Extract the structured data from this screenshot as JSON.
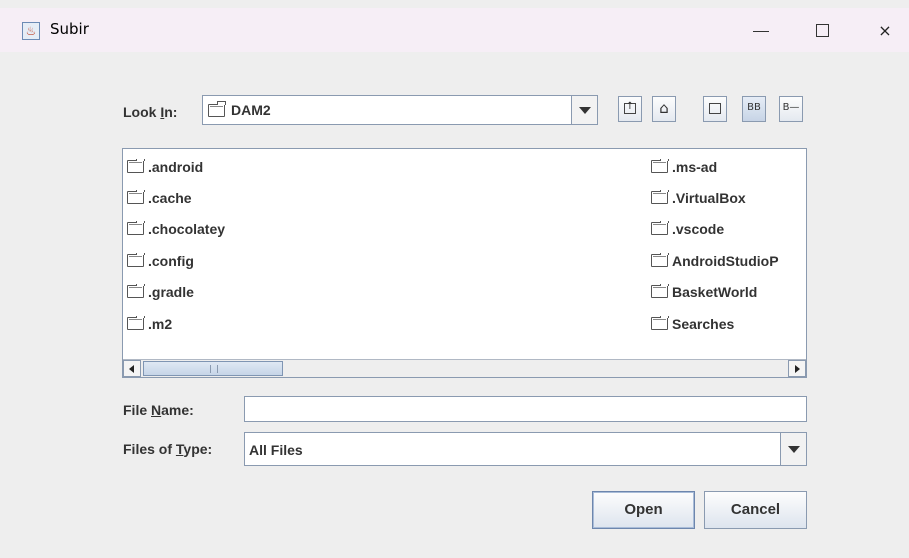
{
  "window": {
    "title": "Subir",
    "controls": {
      "minimize": "minimize",
      "maximize": "maximize",
      "close": "×"
    }
  },
  "toolbar": {
    "look_in_label_prefix": "Look ",
    "look_in_label_mnemonic": "I",
    "look_in_label_suffix": "n:",
    "current_folder": "DAM2",
    "buttons": [
      "up-one-level",
      "home",
      "create-new-folder",
      "list-view",
      "details-view"
    ],
    "list_view_glyph": "BB",
    "details_view_glyph": "B—"
  },
  "files": [
    {
      "name": ".android"
    },
    {
      "name": ".cache"
    },
    {
      "name": ".chocolatey"
    },
    {
      "name": ".config"
    },
    {
      "name": ".gradle"
    },
    {
      "name": ".m2"
    },
    {
      "name": ".ms-ad"
    },
    {
      "name": ".VirtualBox"
    },
    {
      "name": ".vscode"
    },
    {
      "name": "AndroidStudioP"
    },
    {
      "name": "BasketWorld"
    },
    {
      "name": "Searches"
    }
  ],
  "scrollbar": {
    "grip": "III"
  },
  "form": {
    "file_name_label_prefix": "File ",
    "file_name_label_mnemonic": "N",
    "file_name_label_suffix": "ame:",
    "file_name_value": "",
    "file_type_label_prefix": "Files of ",
    "file_type_label_mnemonic": "T",
    "file_type_label_suffix": "ype:",
    "file_type_value": "All Files"
  },
  "actions": {
    "open_label": "Open",
    "cancel_label": "Cancel"
  }
}
